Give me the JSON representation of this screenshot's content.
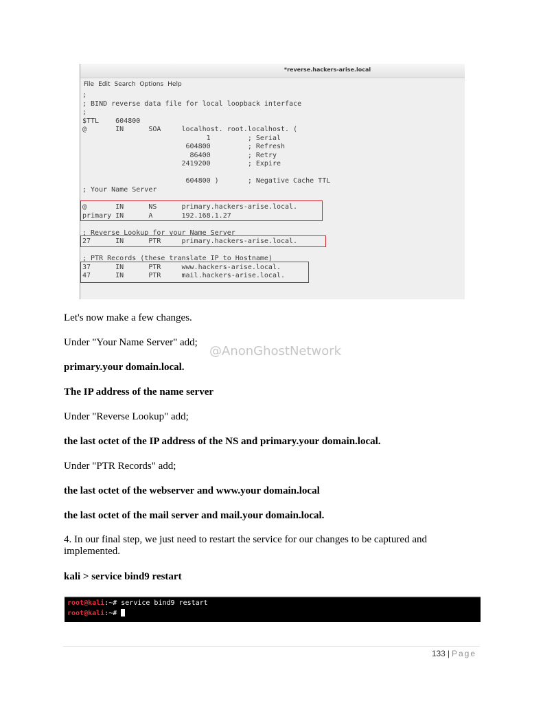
{
  "editor": {
    "title": "*reverse.hackers-arise.local",
    "menu": [
      "File",
      "Edit",
      "Search",
      "Options",
      "Help"
    ],
    "lines": [
      ";",
      "; BIND reverse data file for local loopback interface",
      ";",
      "$TTL    604800",
      "@       IN      SOA     localhost. root.localhost. (",
      "                              1         ; Serial",
      "                         604800         ; Refresh",
      "                          86400         ; Retry",
      "                        2419200         ; Expire",
      "",
      "                         604800 )       ; Negative Cache TTL",
      "; Your Name Server",
      "",
      "@       IN      NS      primary.hackers-arise.local.",
      "primary IN      A       192.168.1.27",
      "",
      "; Reverse Lookup for your Name Server",
      "27      IN      PTR     primary.hackers-arise.local.",
      "",
      "; PTR Records (these translate IP to Hostname)",
      "37      IN      PTR     www.hackers-arise.local.",
      "47      IN      PTR     mail.hackers-arise.local."
    ]
  },
  "doc": {
    "p1": "Let's now make a few changes.",
    "p2": "Under \"Your Name Server\" add;",
    "p3": "primary.your domain.local.",
    "p4": "The IP address of the name server",
    "p5": "Under \"Reverse Lookup\" add;",
    "p6": "the last octet of the IP address of the NS and primary.your domain.local.",
    "p7": "Under \"PTR Records\" add;",
    "p8": "the last octet of the webserver and www.your domain.local",
    "p9": "the last octet of the mail server and mail.your domain.local.",
    "p10": "4. In our final step, we just need to restart the service for our changes to be captured and implemented.",
    "p11": "kali > service bind9 restart"
  },
  "watermark": "@AnonGhostNetwork",
  "terminal": {
    "user": "root@kali",
    "line1_rest": ":~# service bind9 restart",
    "line2_rest": ":~# "
  },
  "footer": {
    "page_number": "133",
    "separator": "|",
    "page_word": "Page"
  },
  "colors": {
    "highlight_box": "#d3212d",
    "terminal_user": "#e3323f"
  }
}
